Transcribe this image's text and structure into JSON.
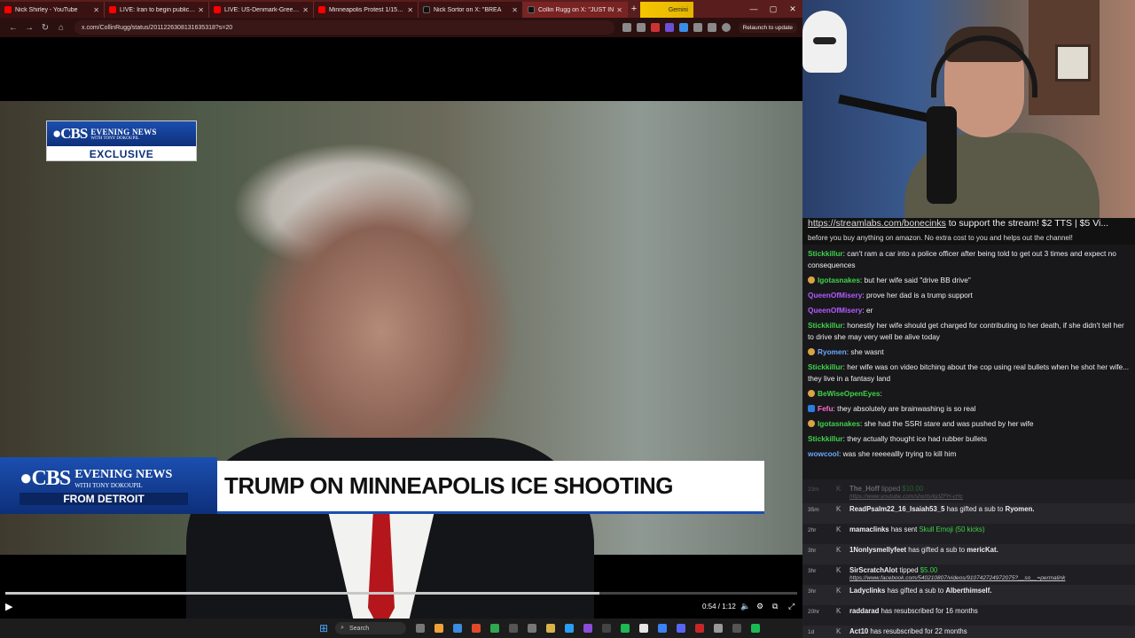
{
  "browser": {
    "tabs": [
      {
        "title": "Nick Shirley - YouTube",
        "active": false
      },
      {
        "title": "LIVE: Iran to begin public exe",
        "active": false
      },
      {
        "title": "LIVE: US-Denmark-Greenland d",
        "active": false
      },
      {
        "title": "Minneapolis Protest 1/15 - You",
        "active": false
      },
      {
        "title": "Nick Sortor on X: \"BREA",
        "active": false
      },
      {
        "title": "Collin Rugg on X: \"JUST IN",
        "active": true
      }
    ],
    "gemini_label": "Gemini",
    "url": "x.com/CollinRugg/status/2011226308131635318?s=20",
    "relaunch_label": "Relaunch to update"
  },
  "video": {
    "top_bug": {
      "logo": "●CBS",
      "name": "EVENING NEWS",
      "with": "WITH TONY DOKOUPIL",
      "tag": "EXCLUSIVE"
    },
    "lower_third": {
      "logo": "●CBS",
      "name": "EVENING NEWS",
      "with": "WITH TONY DOKOUPIL",
      "from": "FROM DETROIT",
      "headline": "TRUMP ON MINNEAPOLIS ICE SHOOTING"
    },
    "time": "0:54 / 1:12",
    "progress": 0.75
  },
  "taskbar": {
    "search_label": "Search"
  },
  "chat": {
    "banner_link": "https://streamlabs.com/bonecinks",
    "banner_rest": " to support the stream! $2 TTS | $5 Vi...",
    "banner_line2": "before you buy anything on amazon. No extra cost to you and helps out the channel!",
    "messages": [
      {
        "user": "Stickkillur",
        "color": "#3fd34a",
        "text": "can't ram a car into a police officer after being told to get out 3 times and expect no consequences",
        "badge": ""
      },
      {
        "user": "Igotasnakes",
        "color": "#3fd34a",
        "text": "but her wife said \"drive BB drive\"",
        "badge": "gold"
      },
      {
        "user": "QueenOfMisery",
        "color": "#b25bff",
        "text": "prove her dad is a trump support",
        "badge": ""
      },
      {
        "user": "QueenOfMisery",
        "color": "#b25bff",
        "text": "er",
        "badge": ""
      },
      {
        "user": "Stickkillur",
        "color": "#3fd34a",
        "text": "honestly her wife should get charged for contributing to her death, if she didn't tell her to drive she may very well be alive today",
        "badge": ""
      },
      {
        "user": "Ryomen",
        "color": "#6aa7ff",
        "text": "she wasnt",
        "badge": "gold"
      },
      {
        "user": "Stickkillur",
        "color": "#3fd34a",
        "text": "her wife was on video bitching about the cop using real bullets when he shot her wife... they live in a fantasy land",
        "badge": ""
      },
      {
        "user": "BeWiseOpenEyes",
        "color": "#3fd34a",
        "text": "",
        "badge": "gold"
      },
      {
        "user": "Fefu",
        "color": "#ff6ad5",
        "text": "they absolutely are brainwashing is so real",
        "badge": "blue"
      },
      {
        "user": "Igotasnakes",
        "color": "#3fd34a",
        "text": "she had the SSRI stare and was pushed by her wife",
        "badge": "gold"
      },
      {
        "user": "Stickkillur",
        "color": "#3fd34a",
        "text": "they actually thought ice had rubber bullets",
        "badge": ""
      },
      {
        "user": "wowcool",
        "color": "#6aa7ff",
        "text": "was she reeeeallly trying to kill him",
        "badge": ""
      }
    ],
    "events": [
      {
        "age": "23m",
        "user": "The_Hoff",
        "text": " tipped ",
        "amount": "$10.00",
        "link": "https://www.youtube.com/shorts/kjrlZFH-cHc",
        "faded": true
      },
      {
        "age": "35m",
        "user": "ReadPsalm22_16_Isaiah53_5",
        "text": " has gifted a sub to ",
        "target": "Ryomen."
      },
      {
        "age": "2hr",
        "user": "mamaclinks",
        "text": " has sent ",
        "green": "Skull Emoji (50 kicks)"
      },
      {
        "age": "3hr",
        "user": "1Nonlysmellyfeet",
        "text": " has gifted a sub to ",
        "target": "mericKat."
      },
      {
        "age": "3hr",
        "user": "SirScratchAlot",
        "text": " tipped ",
        "amount": "$5.00",
        "link": "https://www.facebook.com/540210807/videos/910742724972075?__so__=permalink"
      },
      {
        "age": "3hr",
        "user": "Ladyclinks",
        "text": " has gifted a sub to ",
        "target": "Alberthimself."
      },
      {
        "age": "20hr",
        "user": "raddarad",
        "text": " has resubscribed for 16 months"
      },
      {
        "age": "1d",
        "user": "Act10",
        "text": " has resubscribed for 22 months"
      }
    ]
  }
}
